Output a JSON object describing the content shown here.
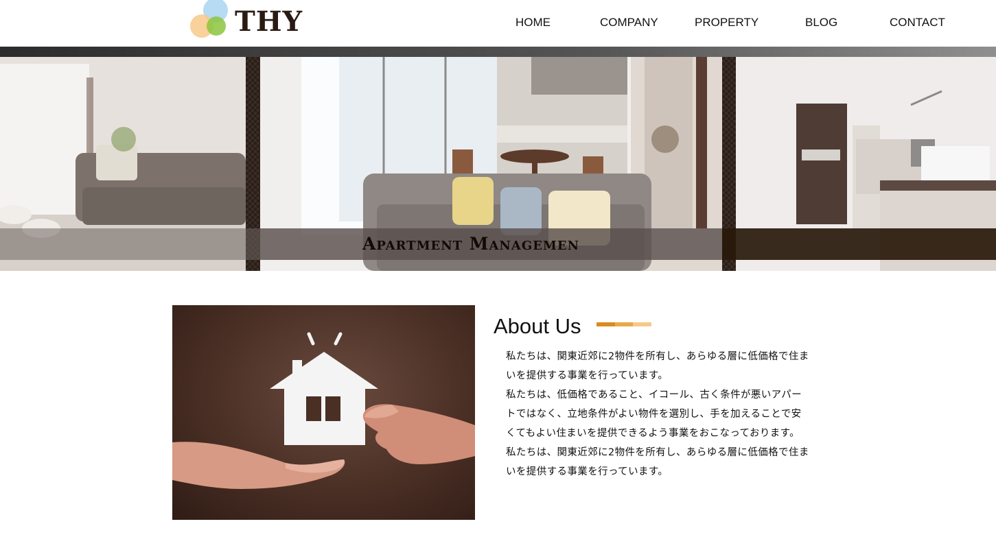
{
  "header": {
    "logo_text": "THY",
    "logo_icon": "overlapping-circles-logo",
    "nav": [
      {
        "label": "HOME"
      },
      {
        "label": "COMPANY"
      },
      {
        "label": "PROPERTY"
      },
      {
        "label": "BLOG"
      },
      {
        "label": "CONTACT"
      }
    ]
  },
  "hero": {
    "title": "Apartment Managemen",
    "images": [
      "living-room-photo",
      "apartment-interior-photo",
      "kitchen-photo"
    ]
  },
  "about": {
    "heading": "About Us",
    "image": "house-handover-photo",
    "accent_colors": [
      "#d98c1f",
      "#e8a94a",
      "#f5c98a"
    ],
    "paragraphs": [
      "私たちは、関東近郊に2物件を所有し、あらゆる層に低価格で住まいを提供する事業を行っています。",
      "私たちは、低価格であること、イコール、古く条件が悪いアパートではなく、立地条件がよい物件を選別し、手を加えることで安くてもよい住まいを提供できるよう事業をおこなっております。",
      "私たちは、関東近郊に2物件を所有し、あらゆる層に低価格で住まいを提供する事業を行っています。"
    ]
  }
}
